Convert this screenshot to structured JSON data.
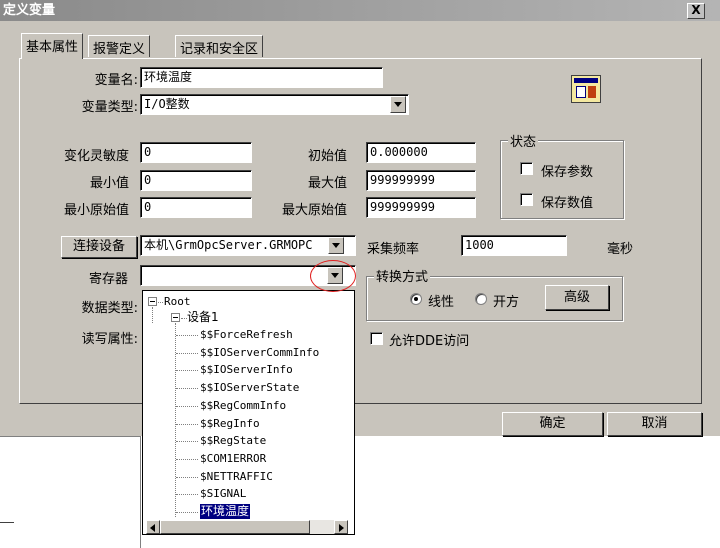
{
  "window": {
    "title": "定义变量",
    "close_label": "X"
  },
  "tabs": [
    {
      "label": "基本属性",
      "active": true
    },
    {
      "label": "报警定义",
      "active": false
    },
    {
      "label": "记录和安全区",
      "active": false
    }
  ],
  "form": {
    "var_name_label": "变量名:",
    "var_name_value": "环境温度",
    "var_type_label": "变量类型:",
    "var_type_value": "I/O整数",
    "sensitivity_label": "变化灵敏度",
    "sensitivity_value": "0",
    "initial_label": "初始值",
    "initial_value": "0.000000",
    "min_label": "最小值",
    "min_value": "0",
    "max_label": "最大值",
    "max_value": "999999999",
    "min_raw_label": "最小原始值",
    "min_raw_value": "0",
    "max_raw_label": "最大原始值",
    "max_raw_value": "999999999",
    "connect_button": "连接设备",
    "device_value": "本机\\GrmOpcServer.GRMOPC",
    "sample_rate_label": "采集频率",
    "sample_rate_value": "1000",
    "sample_rate_unit": "毫秒",
    "register_label": "寄存器",
    "register_value": "",
    "data_type_label": "数据类型:",
    "rw_label": "读写属性:",
    "allow_dde_label": "允许DDE访问"
  },
  "status_group": {
    "title": "状态",
    "save_params": "保存参数",
    "save_value": "保存数值"
  },
  "convert_group": {
    "title": "转换方式",
    "linear": "线性",
    "sqrt": "开方",
    "advanced_button": "高级",
    "selected": "linear"
  },
  "buttons": {
    "ok": "确定",
    "cancel": "取消"
  },
  "tree": {
    "root": "Root",
    "device": "设备1",
    "items": [
      "$$ForceRefresh",
      "$$IOServerCommInfo",
      "$$IOServerInfo",
      "$$IOServerState",
      "$$RegCommInfo",
      "$$RegInfo",
      "$$RegState",
      "$COM1ERROR",
      "$NETTRAFFIC",
      "$SIGNAL",
      "环境温度"
    ],
    "selected_index": 10
  },
  "colors": {
    "dialog_bg": "#c8c4bc",
    "selection": "#000080",
    "annotation": "#e02020"
  }
}
